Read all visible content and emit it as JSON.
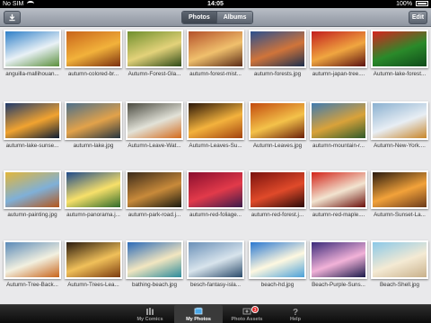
{
  "status": {
    "carrier": "No SIM",
    "time": "14:05",
    "battery": "100%"
  },
  "toolbar": {
    "download_icon": "download-arrow-icon",
    "tabs": [
      {
        "label": "Photos",
        "active": true
      },
      {
        "label": "Albums",
        "active": false
      }
    ],
    "edit_label": "Edit"
  },
  "photos": [
    {
      "label": "anguilla-mallihouan...",
      "c1": "#2e7fc8",
      "c2": "#e9f1f6",
      "c3": "#5a8f3c"
    },
    {
      "label": "autumn-colored-br...",
      "c1": "#c8641a",
      "c2": "#f2b23b",
      "c3": "#7a2e0e"
    },
    {
      "label": "Autumn-Forest-Gla...",
      "c1": "#6f8f2d",
      "c2": "#e3d27a",
      "c3": "#2e4a17"
    },
    {
      "label": "autumn-forest-mist...",
      "c1": "#b4502a",
      "c2": "#f0c06d",
      "c3": "#5a2a16"
    },
    {
      "label": "autumn-forests.jpg",
      "c1": "#2b4f8f",
      "c2": "#d0743a",
      "c3": "#1c2f4e"
    },
    {
      "label": "autumn-japan-tree....",
      "c1": "#c21e1e",
      "c2": "#f0a640",
      "c3": "#5a1010"
    },
    {
      "label": "Autumn-lake-forest...",
      "c1": "#d6231e",
      "c2": "#2a8a2a",
      "c3": "#0f4a1a"
    },
    {
      "label": "autumn-lake-sunse...",
      "c1": "#1f3a6b",
      "c2": "#f1a330",
      "c3": "#0e1c33"
    },
    {
      "label": "autumn-lake.jpg",
      "c1": "#4c6f8a",
      "c2": "#e2a24a",
      "c3": "#253440"
    },
    {
      "label": "Autumn-Leave-Wat...",
      "c1": "#4a4a40",
      "c2": "#e2e2d8",
      "c3": "#d46b1c"
    },
    {
      "label": "Autumn-Leaves-Su...",
      "c1": "#2a1608",
      "c2": "#f3b23d",
      "c3": "#a2420e"
    },
    {
      "label": "Autumn-Leaves.jpg",
      "c1": "#c24a0e",
      "c2": "#f4c24a",
      "c3": "#6a200a"
    },
    {
      "label": "autumn-mountain-r...",
      "c1": "#3f7ab0",
      "c2": "#d9a23a",
      "c3": "#2e5a2a"
    },
    {
      "label": "Autumn-New-York....",
      "c1": "#8ab0d0",
      "c2": "#e8eef4",
      "c3": "#c8862a"
    },
    {
      "label": "autumn-painting.jpg",
      "c1": "#e2b63a",
      "c2": "#7fb0d8",
      "c3": "#b4561a"
    },
    {
      "label": "autumn-panorama.j...",
      "c1": "#1e4a8a",
      "c2": "#f7e06a",
      "c3": "#2e6a2a"
    },
    {
      "label": "autumn-park-road.j...",
      "c1": "#3a2a1a",
      "c2": "#c88a3a",
      "c3": "#1a1a10"
    },
    {
      "label": "autumn-red-foliage...",
      "c1": "#8a0e2e",
      "c2": "#e23a4a",
      "c3": "#3a1a4a"
    },
    {
      "label": "autumn-red-forest.j...",
      "c1": "#7a120e",
      "c2": "#e04a2a",
      "c3": "#2a0a08"
    },
    {
      "label": "autumn-red-maple....",
      "c1": "#d2241a",
      "c2": "#f2e4d0",
      "c3": "#6a0e0a"
    },
    {
      "label": "Autumn-Sunset-La...",
      "c1": "#2a1a0e",
      "c2": "#f2a23a",
      "c3": "#6a3a1a"
    },
    {
      "label": "Autumn-Tree-Back...",
      "c1": "#5a8ab8",
      "c2": "#f2f0e0",
      "c3": "#c8641a"
    },
    {
      "label": "Autumn-Trees-Lea...",
      "c1": "#2a1a0e",
      "c2": "#f0c05a",
      "c3": "#7a3a0e"
    },
    {
      "label": "bathing-beach.jpg",
      "c1": "#2a6ab8",
      "c2": "#f2e6c0",
      "c3": "#2a8a9a"
    },
    {
      "label": "besch-fantasy-isla...",
      "c1": "#6a90b8",
      "c2": "#d8e4ec",
      "c3": "#2a4a6a"
    },
    {
      "label": "beach-hd.jpg",
      "c1": "#2a78d0",
      "c2": "#fef8e0",
      "c3": "#4aa0d8"
    },
    {
      "label": "Beach-Purple-Suns...",
      "c1": "#3a2a7a",
      "c2": "#f2b2d8",
      "c3": "#1a1a4a"
    },
    {
      "label": "Beach-Shell.jpg",
      "c1": "#8ac8e8",
      "c2": "#f4ead4",
      "c3": "#c8b08a"
    }
  ],
  "tabbar": [
    {
      "label": "My Comics",
      "icon": "books-icon",
      "active": false
    },
    {
      "label": "My Photos",
      "icon": "photos-icon",
      "active": true
    },
    {
      "label": "Photo Assets",
      "icon": "photo-assets-icon",
      "active": false,
      "badge": "3"
    },
    {
      "label": "Help",
      "icon": "help-question-icon",
      "active": false
    }
  ]
}
